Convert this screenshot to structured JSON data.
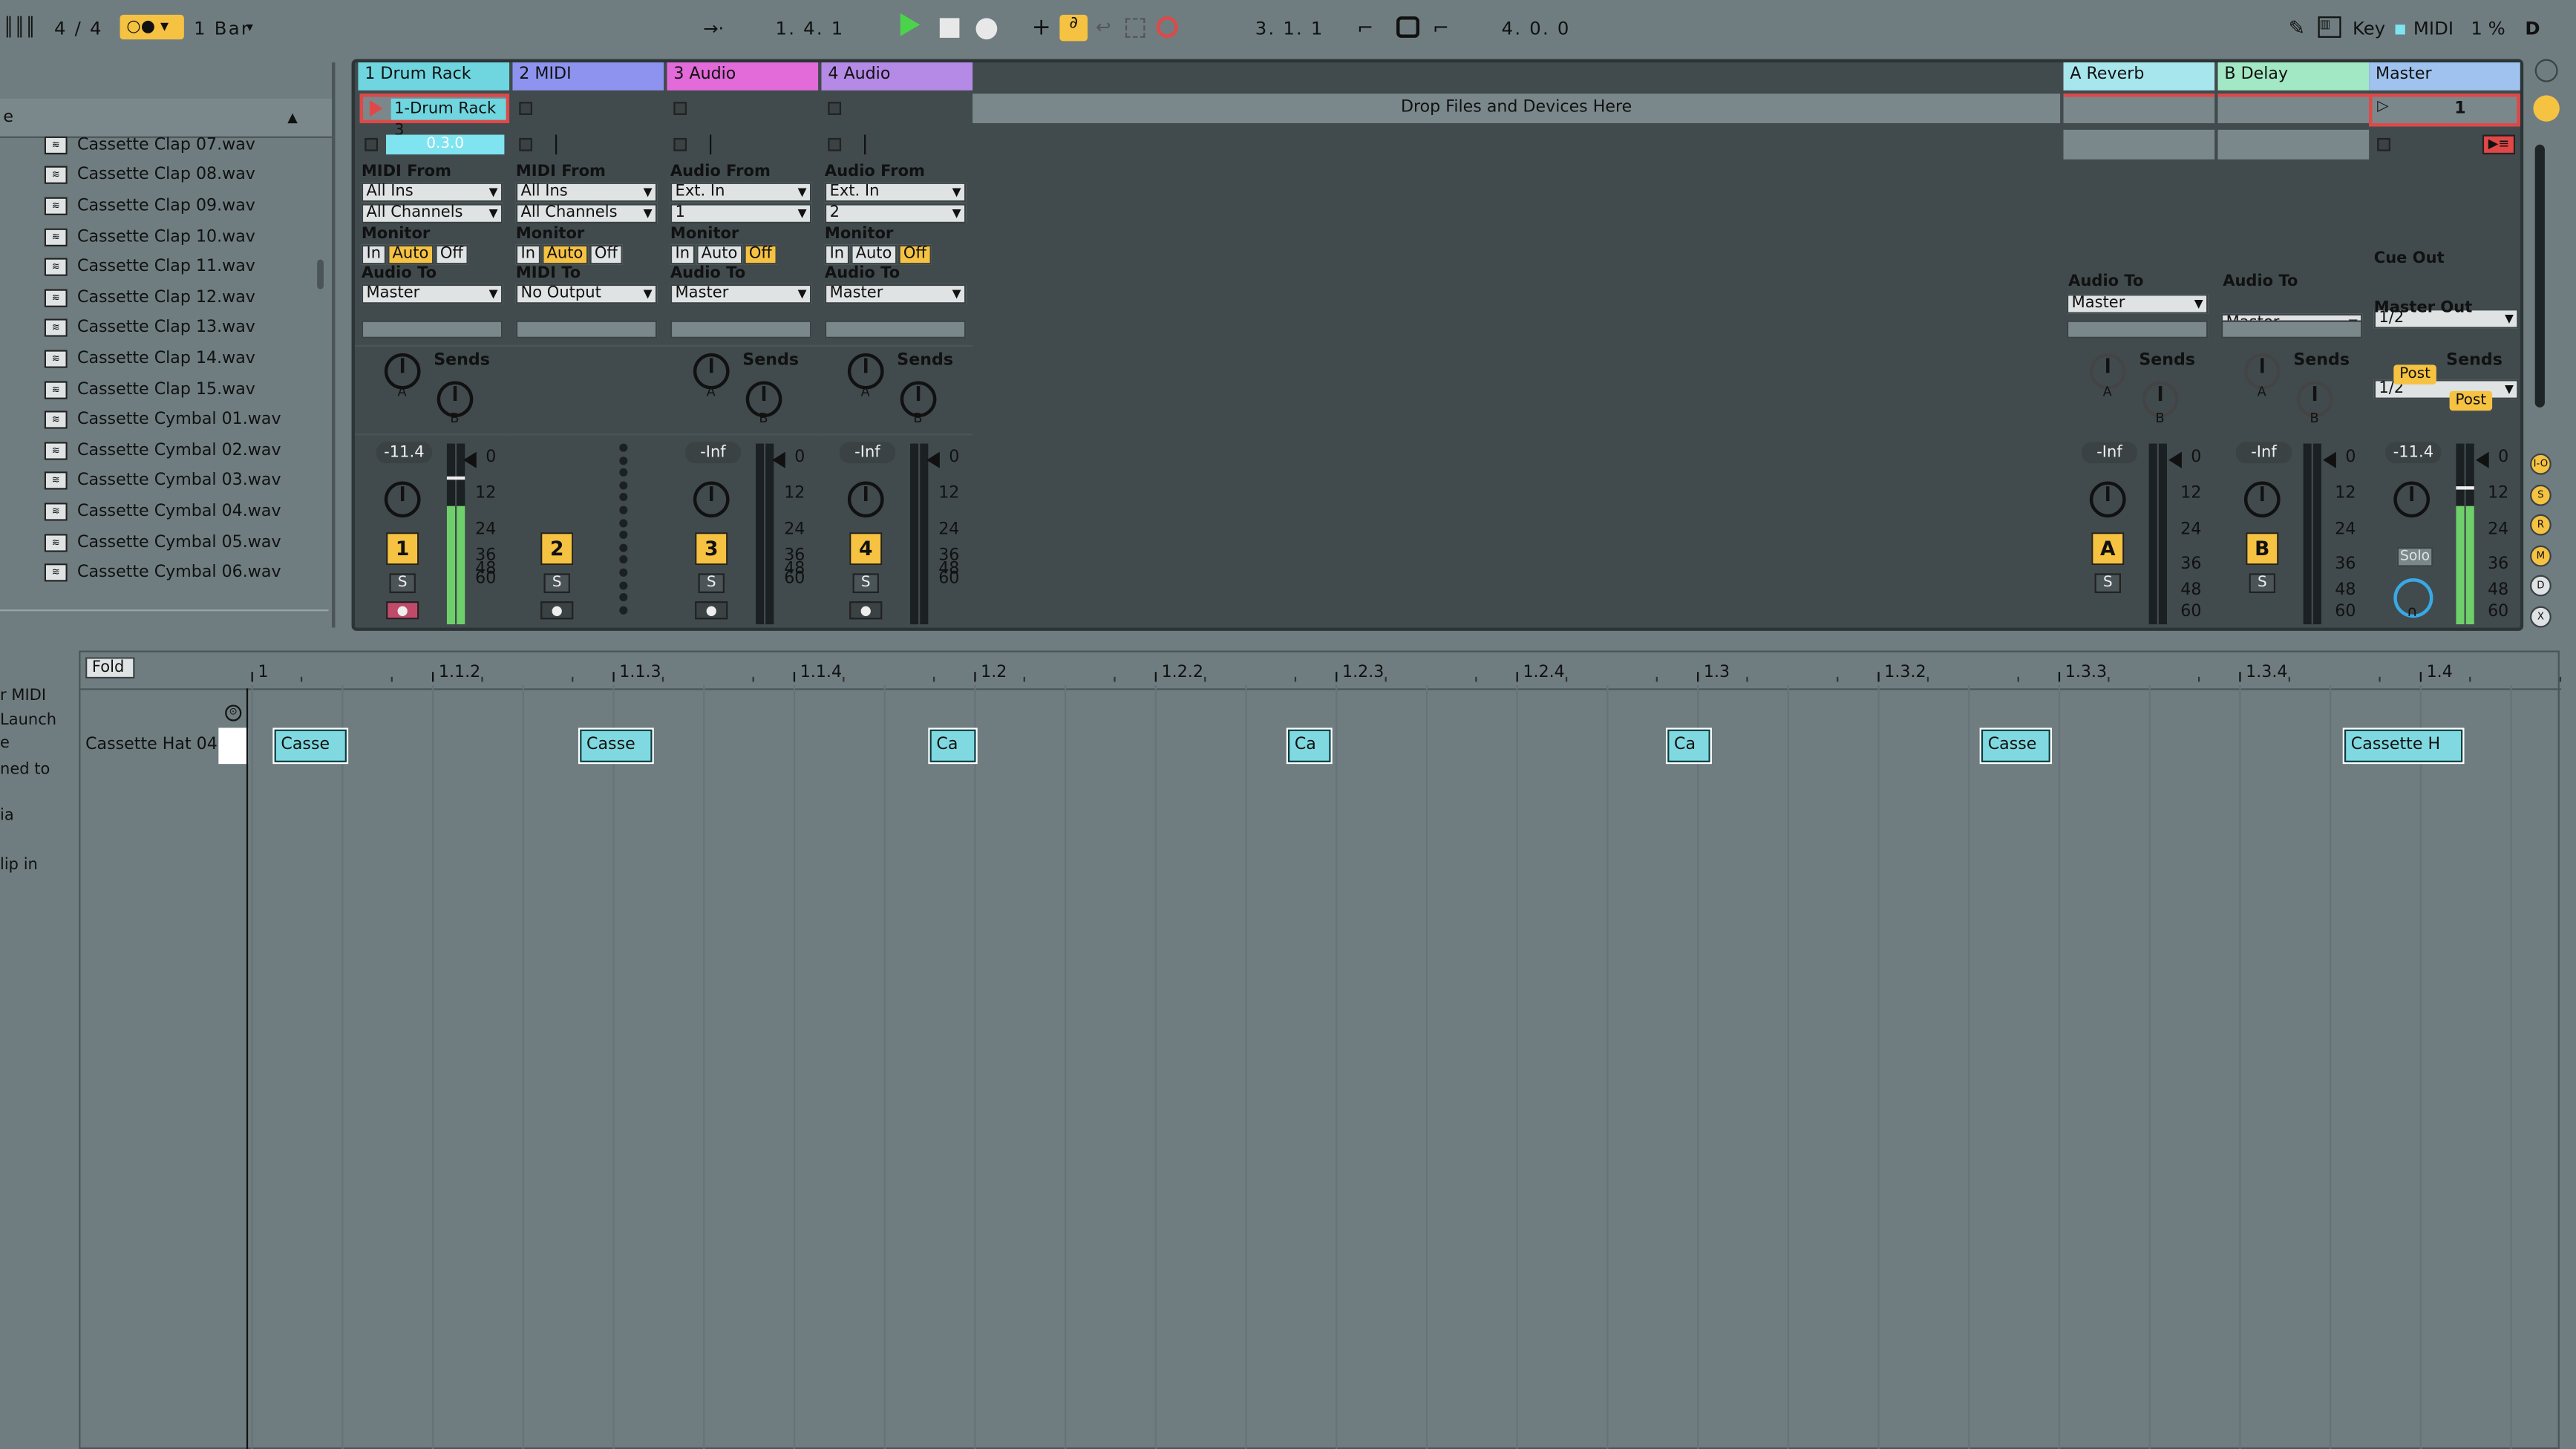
{
  "transport": {
    "time_sig": "4 / 4",
    "quantize": "1 Bar",
    "arrangement_position": "1.  4.  1",
    "loop_start": "3.  1.  1",
    "loop_length": "4.  0.  0",
    "key_label": "Key",
    "midi_label": "MIDI",
    "cpu": "1 %",
    "d_label": "D"
  },
  "browser": {
    "header_label": "e",
    "items": [
      "Cassette Clap 07.wav",
      "Cassette Clap 08.wav",
      "Cassette Clap 09.wav",
      "Cassette Clap 10.wav",
      "Cassette Clap 11.wav",
      "Cassette Clap 12.wav",
      "Cassette Clap 13.wav",
      "Cassette Clap 14.wav",
      "Cassette Clap 15.wav",
      "Cassette Cymbal 01.wav",
      "Cassette Cymbal 02.wav",
      "Cassette Cymbal 03.wav",
      "Cassette Cymbal 04.wav",
      "Cassette Cymbal 05.wav",
      "Cassette Cymbal 06.wav"
    ]
  },
  "session": {
    "drop_hint": "Drop Files and Devices Here",
    "sends_label": "Sends",
    "tracks": [
      {
        "name": "1 Drum Rack",
        "color": "#6fd6e0",
        "clip": "1-Drum Rack 3",
        "clip_pos": "0.3.0",
        "in_label": "MIDI From",
        "in_src": "All Ins",
        "in_ch": "All Channels",
        "monitor": "Monitor",
        "out_label": "Audio To",
        "out": "Master",
        "vol": "-11.4",
        "num": "1"
      },
      {
        "name": "2 MIDI",
        "color": "#8d93ee",
        "in_label": "MIDI From",
        "in_src": "All Ins",
        "in_ch": "All Channels",
        "monitor": "Monitor",
        "out_label": "MIDI To",
        "out": "No Output",
        "num": "2"
      },
      {
        "name": "3 Audio",
        "color": "#e26ad9",
        "in_label": "Audio From",
        "in_src": "Ext. In",
        "in_ch": "1",
        "monitor": "Monitor",
        "out_label": "Audio To",
        "out": "Master",
        "vol": "-Inf",
        "num": "3"
      },
      {
        "name": "4 Audio",
        "color": "#b58ae6",
        "in_label": "Audio From",
        "in_src": "Ext. In",
        "in_ch": "2",
        "monitor": "Monitor",
        "out_label": "Audio To",
        "out": "Master",
        "vol": "-Inf",
        "num": "4"
      }
    ],
    "returns": [
      {
        "name": "A Reverb",
        "color": "#a8e6ee",
        "out_label": "Audio To",
        "out": "Master",
        "vol": "-Inf",
        "num": "A"
      },
      {
        "name": "B Delay",
        "color": "#a3e8c4",
        "out_label": "Audio To",
        "out": "Master",
        "vol": "-Inf",
        "num": "B"
      }
    ],
    "master": {
      "name": "Master",
      "color": "#9fc3ee",
      "scene": "1",
      "cue_label": "Cue Out",
      "cue": "1/2",
      "out_label": "Master Out",
      "out": "1/2",
      "vol": "-11.4",
      "post": "Post",
      "solo": "Solo"
    },
    "monitor_opts": [
      "In",
      "Auto",
      "Off"
    ],
    "send_a": "A",
    "send_b": "B",
    "s_label": "S",
    "db_scale": [
      "0",
      "12",
      "24",
      "36",
      "48",
      "60"
    ]
  },
  "arrangement": {
    "fold_label": "Fold",
    "track_name": "Cassette Hat 04",
    "left_labels": [
      "r MIDI",
      "Launch",
      "e",
      "ned to",
      "ia",
      "lip in"
    ],
    "ruler": [
      "1",
      "1.1.2",
      "1.1.3",
      "1.1.4",
      "1.2",
      "1.2.2",
      "1.2.3",
      "1.2.4",
      "1.3",
      "1.3.2",
      "1.3.3",
      "1.3.4",
      "1.4"
    ],
    "clips": [
      "Casse",
      "Casse",
      "Ca",
      "Ca",
      "Ca",
      "Casse",
      "Cassette H"
    ]
  },
  "right_buttons": [
    "I-O",
    "S",
    "R",
    "M",
    "D",
    "X"
  ]
}
